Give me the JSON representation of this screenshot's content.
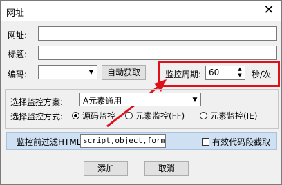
{
  "window": {
    "title": "网址",
    "close_glyph": "✕"
  },
  "form": {
    "url_label": "网址:",
    "url_value": "",
    "title_label": "标题:",
    "title_value": "",
    "encoding_label": "编码:",
    "encoding_value": "",
    "auto_fetch_button": "自动获取",
    "monitor_period_label": "监控周期:",
    "monitor_period_value": "60",
    "monitor_period_unit": "秒/次"
  },
  "scheme": {
    "label": "选择监控方案:",
    "selected": "A元素通用"
  },
  "mode": {
    "label": "选择监控方式:",
    "options": [
      {
        "label": "源码监控",
        "selected": true
      },
      {
        "label": "元素监控(FF)",
        "selected": false
      },
      {
        "label": "元素监控(IE)",
        "selected": false
      }
    ]
  },
  "filter": {
    "label": "监控前过滤HTML",
    "value": "script,object,form",
    "valid_code_label": "有效代码段截取",
    "valid_code_checked": false
  },
  "buttons": {
    "add": "添加",
    "cancel": "取消"
  },
  "colors": {
    "highlight": "#e0101a",
    "filter_bar": "#cfe0f3"
  }
}
